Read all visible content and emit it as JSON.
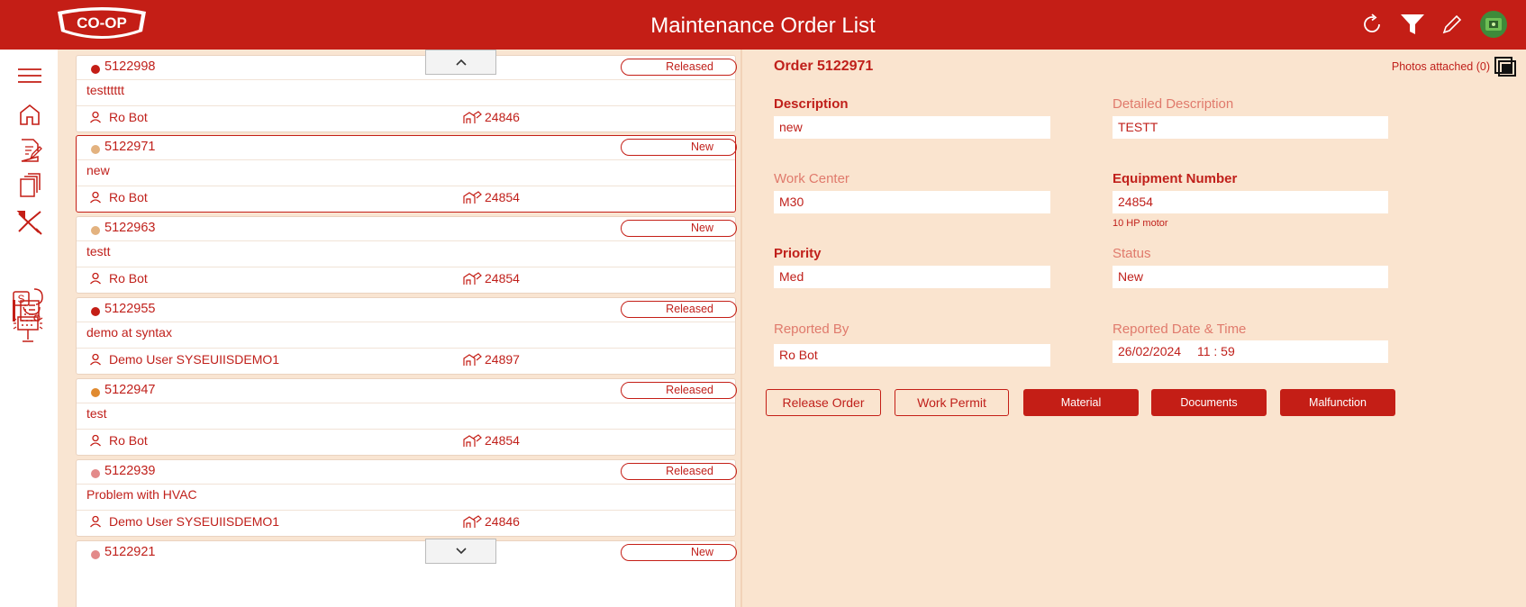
{
  "header": {
    "logo_text": "CO-OP",
    "title": "Maintenance Order List",
    "icons": [
      "refresh-icon",
      "filter-icon",
      "edit-icon",
      "user-avatar"
    ]
  },
  "sidebar": {
    "items": [
      {
        "icon": "menu-icon"
      },
      {
        "icon": "home-icon"
      },
      {
        "icon": "create-order-icon"
      },
      {
        "icon": "documents-icon"
      },
      {
        "icon": "tools-icon"
      },
      {
        "icon": "order-list-icon",
        "active": true
      },
      {
        "icon": "services-icon"
      },
      {
        "icon": "scoreboard-icon"
      }
    ]
  },
  "orders": [
    {
      "number": "5122998",
      "status": "Released",
      "dot": "#c41e16",
      "description": "testttttt",
      "user": "Ro Bot",
      "equipment": "24846"
    },
    {
      "number": "5122971",
      "status": "New",
      "dot": "#e3b27f",
      "description": "new",
      "user": "Ro Bot",
      "equipment": "24854",
      "selected": true
    },
    {
      "number": "5122963",
      "status": "New",
      "dot": "#e3b27f",
      "description": "testt",
      "user": "Ro Bot",
      "equipment": "24854"
    },
    {
      "number": "5122955",
      "status": "Released",
      "dot": "#c41e16",
      "description": "demo at syntax",
      "user": "Demo User SYSEUIISDEMO1",
      "equipment": "24897"
    },
    {
      "number": "5122947",
      "status": "Released",
      "dot": "#e08a30",
      "description": "test",
      "user": "Ro Bot",
      "equipment": "24854"
    },
    {
      "number": "5122939",
      "status": "Released",
      "dot": "#e38a8a",
      "description": "Problem with HVAC",
      "user": "Demo User SYSEUIISDEMO1",
      "equipment": "24846"
    },
    {
      "number": "5122921",
      "status": "New",
      "dot": "#e38a8a",
      "description": "",
      "user": "",
      "equipment": ""
    }
  ],
  "detail": {
    "order_title": "Order 5122971",
    "photos_label": "Photos attached (0)",
    "description_label": "Description",
    "description_value": "new",
    "detailed_description_label": "Detailed Description",
    "detailed_description_value": "TESTT",
    "work_center_label": "Work Center",
    "work_center_value": "M30",
    "equipment_label": "Equipment Number",
    "equipment_value": "24854",
    "equipment_sub": "10 HP motor",
    "priority_label": "Priority",
    "priority_value": "Med",
    "status_label": "Status",
    "status_value": "New",
    "reported_by_label": "Reported By",
    "reported_by_value": "Ro Bot",
    "reported_date_label": "Reported Date & Time",
    "reported_date_value": "26/02/2024",
    "reported_time_value": "11 : 59"
  },
  "buttons": {
    "release_order": "Release Order",
    "work_permit": "Work Permit",
    "material": "Material",
    "documents": "Documents",
    "malfunction": "Malfunction"
  },
  "colors": {
    "brand_red": "#c41e16",
    "panel_bg": "#fae4cf",
    "list_bg": "#f9e5d2"
  }
}
